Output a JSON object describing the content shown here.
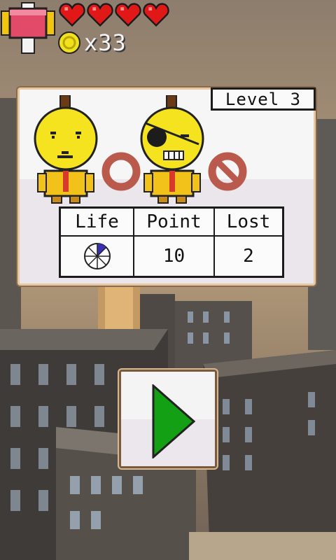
{
  "hud": {
    "hearts": 4,
    "coin_count": "x33",
    "icons": [
      "hammer-icon",
      "heart-icon",
      "coin-icon"
    ]
  },
  "level_panel": {
    "level_label": "Level 3",
    "characters": [
      "sad-yellow-character",
      "eyepatch-yellow-character"
    ],
    "markers": [
      "ring-marker",
      "prohibited-marker"
    ],
    "stats": {
      "headers": [
        "Life",
        "Point",
        "Lost"
      ],
      "life_fraction": 0.125,
      "point": "10",
      "lost": "2"
    }
  },
  "play_button": {
    "icon": "play-icon"
  },
  "colors": {
    "heart": "#e01818",
    "coin": "#f2e21b",
    "ring": "#b95a4c",
    "play_arrow": "#14a014",
    "character_yellow": "#f5e31f"
  }
}
